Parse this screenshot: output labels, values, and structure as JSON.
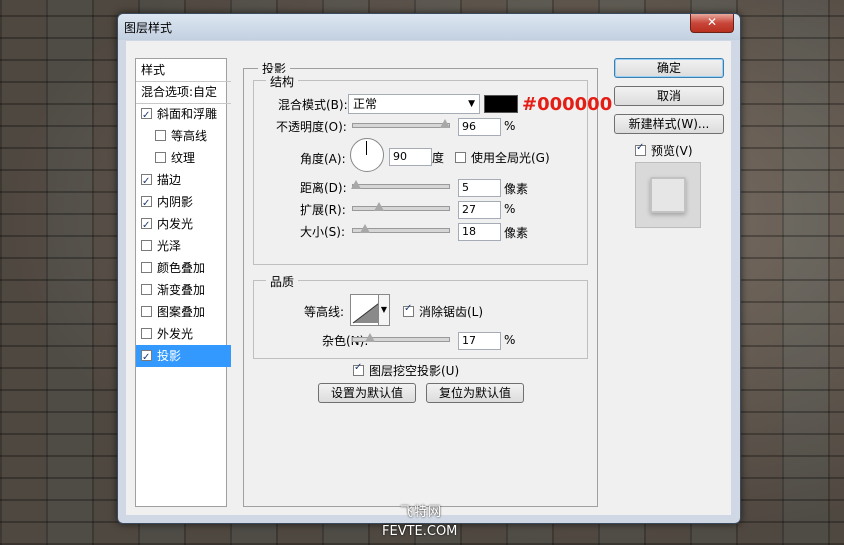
{
  "window": {
    "title": "图层样式",
    "close_label": "✕"
  },
  "style_list": {
    "header": "样式",
    "blend_options": "混合选项:自定",
    "items": [
      {
        "label": "斜面和浮雕",
        "checked": true,
        "indent": false,
        "selected": false
      },
      {
        "label": "等高线",
        "checked": false,
        "indent": true,
        "selected": false
      },
      {
        "label": "纹理",
        "checked": false,
        "indent": true,
        "selected": false
      },
      {
        "label": "描边",
        "checked": true,
        "indent": false,
        "selected": false
      },
      {
        "label": "内阴影",
        "checked": true,
        "indent": false,
        "selected": false
      },
      {
        "label": "内发光",
        "checked": true,
        "indent": false,
        "selected": false
      },
      {
        "label": "光泽",
        "checked": false,
        "indent": false,
        "selected": false
      },
      {
        "label": "颜色叠加",
        "checked": false,
        "indent": false,
        "selected": false
      },
      {
        "label": "渐变叠加",
        "checked": false,
        "indent": false,
        "selected": false
      },
      {
        "label": "图案叠加",
        "checked": false,
        "indent": false,
        "selected": false
      },
      {
        "label": "外发光",
        "checked": false,
        "indent": false,
        "selected": false
      },
      {
        "label": "投影",
        "checked": true,
        "indent": false,
        "selected": true
      }
    ]
  },
  "drop_shadow": {
    "section_title": "投影",
    "structure": {
      "title": "结构",
      "blend_mode_label": "混合模式(B):",
      "blend_mode_value": "正常",
      "color_hex": "#000000",
      "opacity_label": "不透明度(O):",
      "opacity_value": "96",
      "opacity_unit": "%",
      "angle_label": "角度(A):",
      "angle_value": "90",
      "angle_unit": "度",
      "global_light_label": "使用全局光(G)",
      "global_light_checked": false,
      "distance_label": "距离(D):",
      "distance_value": "5",
      "distance_unit": "像素",
      "spread_label": "扩展(R):",
      "spread_value": "27",
      "spread_unit": "%",
      "size_label": "大小(S):",
      "size_value": "18",
      "size_unit": "像素"
    },
    "quality": {
      "title": "品质",
      "contour_label": "等高线:",
      "antialias_label": "消除锯齿(L)",
      "antialias_checked": true,
      "noise_label": "杂色(N):",
      "noise_value": "17",
      "noise_unit": "%"
    },
    "knockout_label": "图层挖空投影(U)",
    "knockout_checked": true,
    "set_default_label": "设置为默认值",
    "reset_default_label": "复位为默认值"
  },
  "buttons": {
    "ok": "确定",
    "cancel": "取消",
    "new_style": "新建样式(W)...",
    "preview_label": "预览(V)",
    "preview_checked": true
  },
  "annotation": "#000000",
  "watermark": {
    "line1": "飞特网",
    "line2": "FEVTE.COM"
  }
}
